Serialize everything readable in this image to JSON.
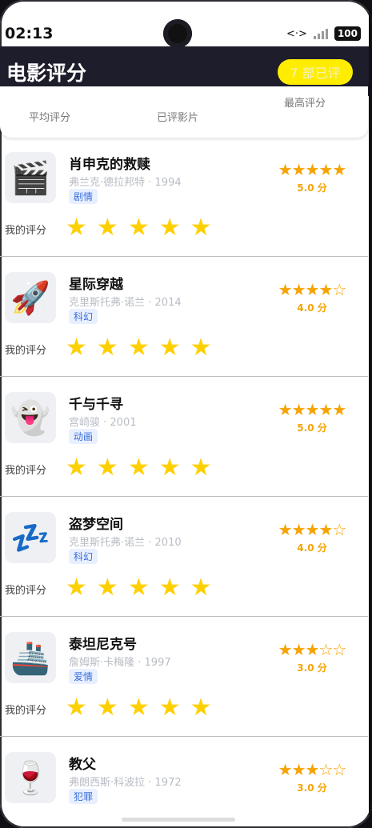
{
  "status_bar": {
    "time": "02:13",
    "battery": "100",
    "network_icon": "<·>"
  },
  "header": {
    "title": "电影评分",
    "rated_badge": "7 部已评"
  },
  "stats": {
    "avg_label": "平均评分",
    "count_label": "已评影片",
    "max_label": "最高评分"
  },
  "my_rating_label": "我的评分",
  "movies": [
    {
      "title": "肖申克的救赎",
      "meta": "弗兰克·德拉邦特 · 1994",
      "genre": "剧情",
      "icon": "🎬",
      "stars": "★★★★★",
      "score": "5.0 分"
    },
    {
      "title": "星际穿越",
      "meta": "克里斯托弗·诺兰 · 2014",
      "genre": "科幻",
      "icon": "🚀",
      "stars": "★★★★☆",
      "score": "4.0 分"
    },
    {
      "title": "千与千寻",
      "meta": "宫崎骏 · 2001",
      "genre": "动画",
      "icon": "👻",
      "stars": "★★★★★",
      "score": "5.0 分"
    },
    {
      "title": "盗梦空间",
      "meta": "克里斯托弗·诺兰 · 2010",
      "genre": "科幻",
      "icon": "💤",
      "stars": "★★★★☆",
      "score": "4.0 分"
    },
    {
      "title": "泰坦尼克号",
      "meta": "詹姆斯·卡梅隆 · 1997",
      "genre": "爱情",
      "icon": "🚢",
      "stars": "★★★☆☆",
      "score": "3.0 分"
    },
    {
      "title": "教父",
      "meta": "弗朗西斯·科波拉 · 1972",
      "genre": "犯罪",
      "icon": "🍷",
      "stars": "★★★☆☆",
      "score": "3.0 分"
    }
  ],
  "my_stars": "★"
}
